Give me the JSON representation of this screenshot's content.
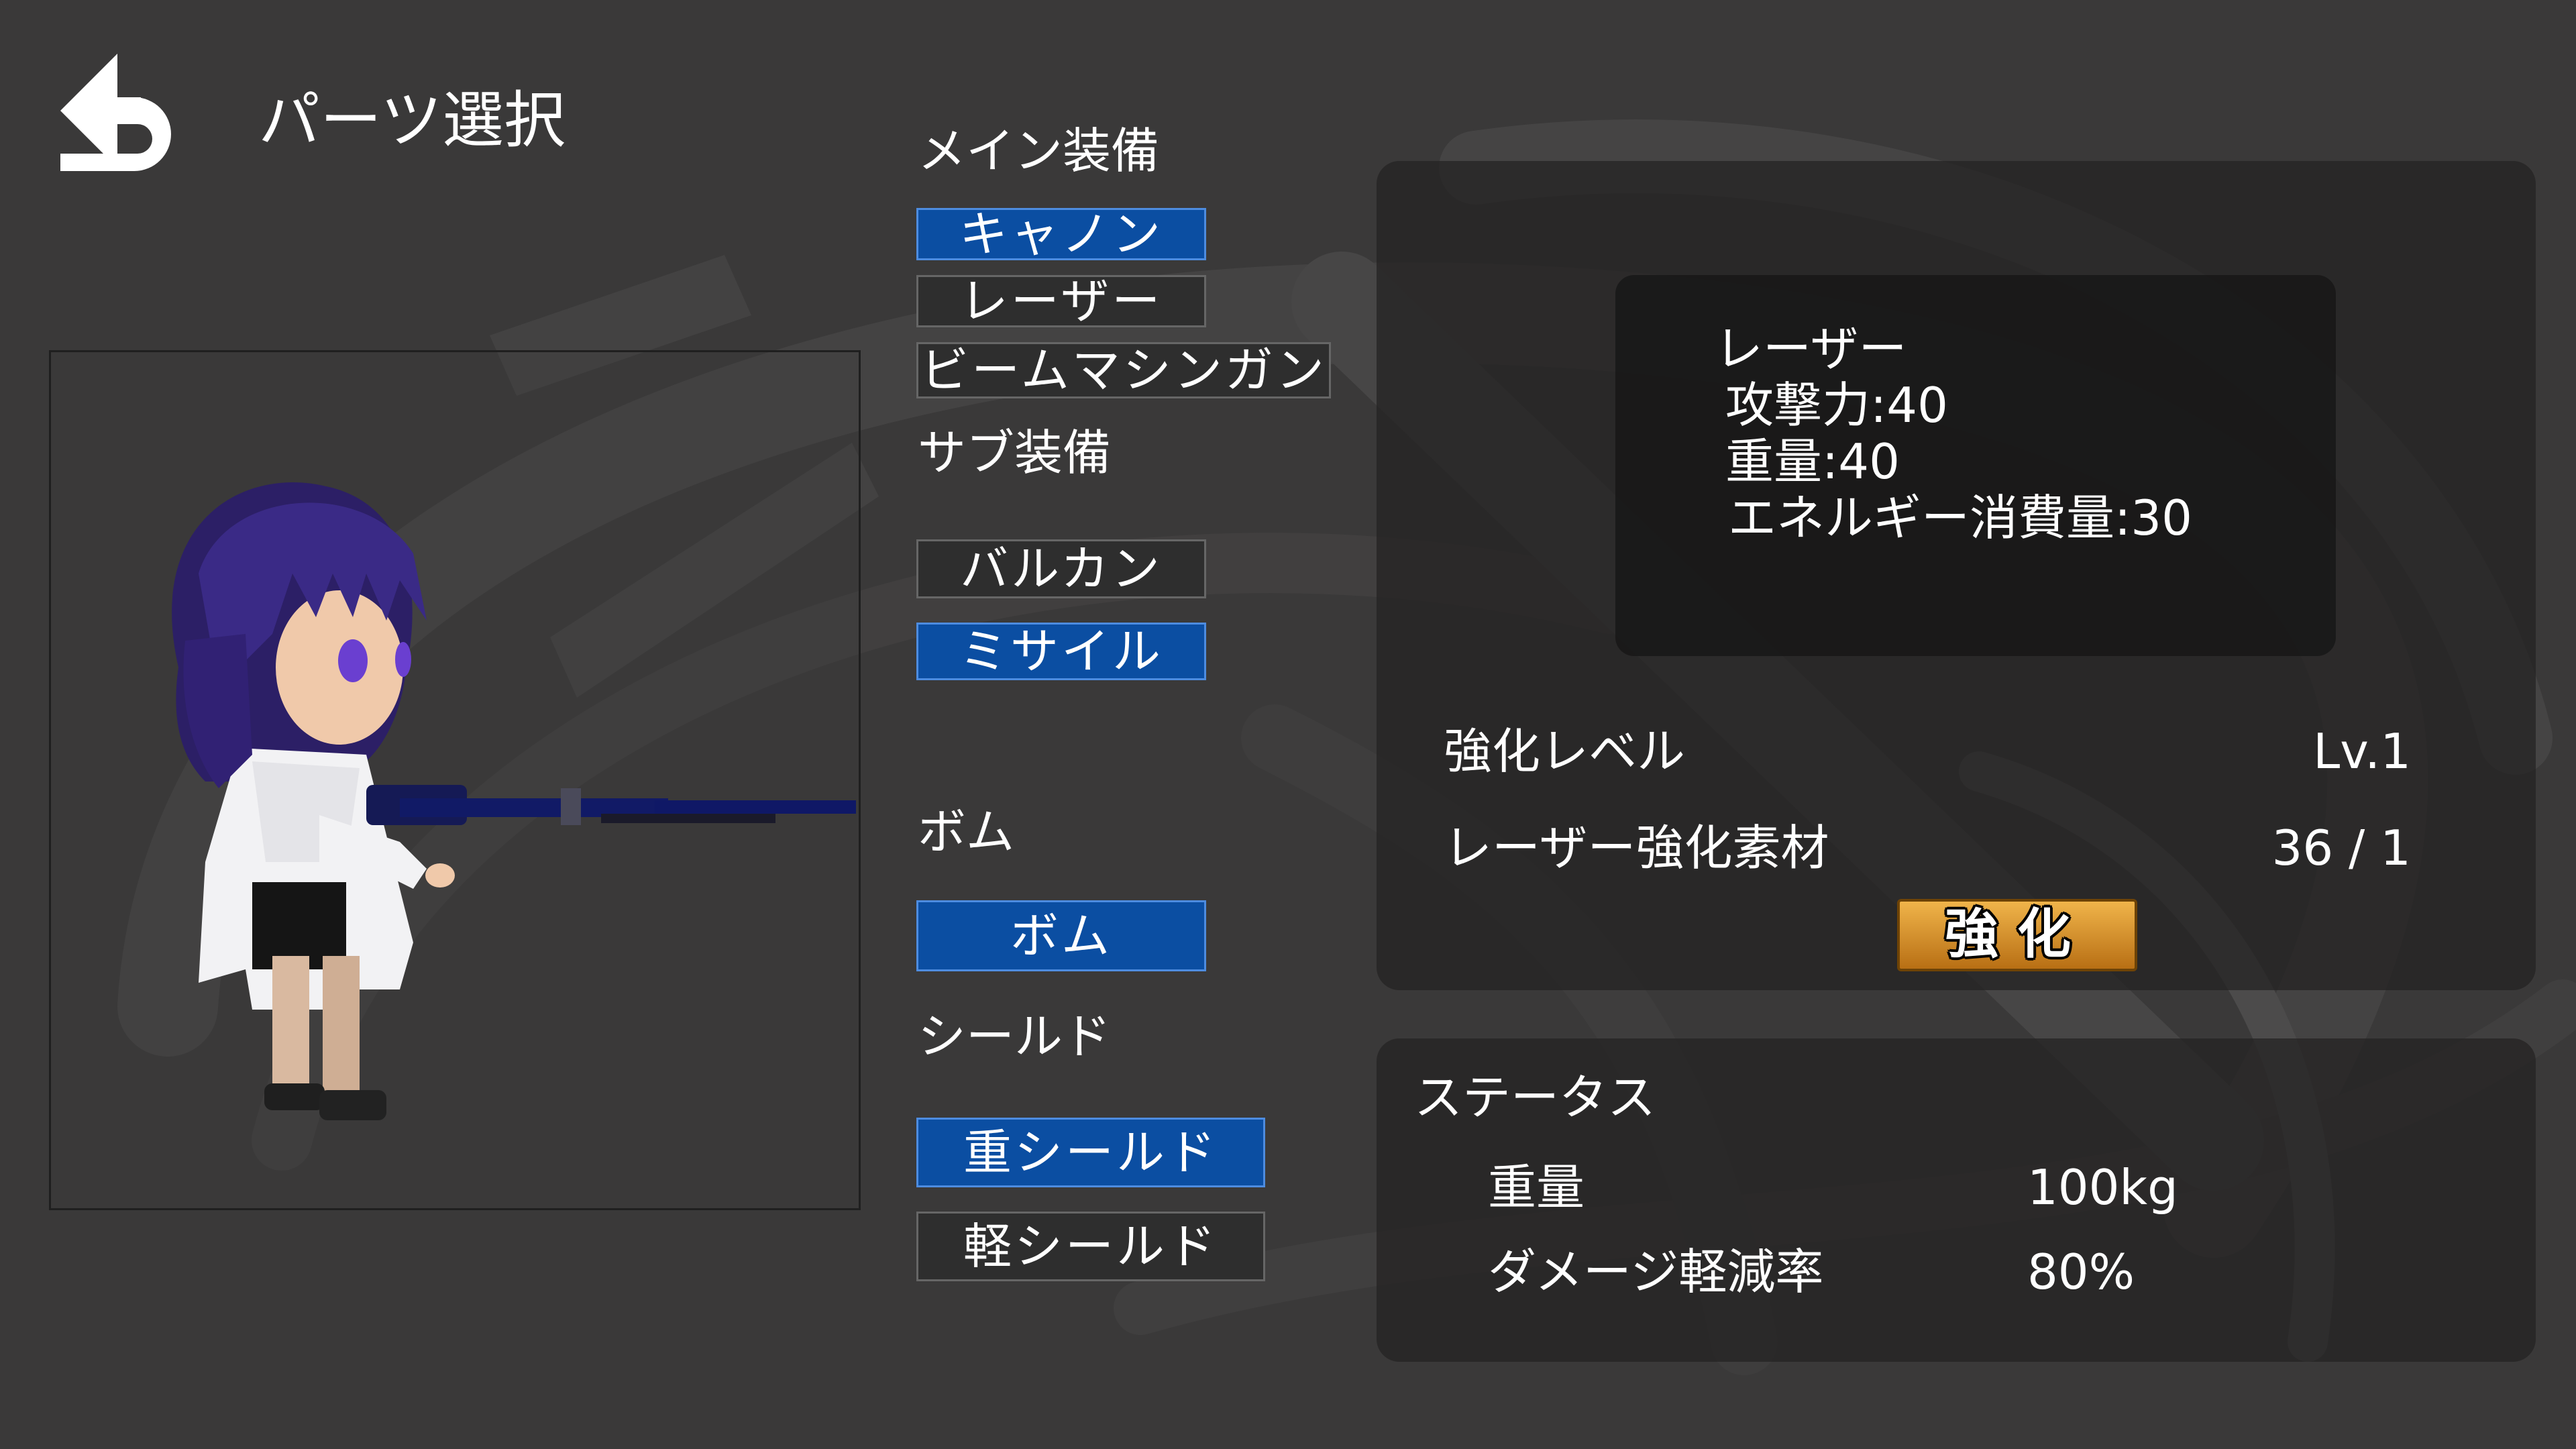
{
  "header": {
    "title": "パーツ選択"
  },
  "icons": {
    "back": "back-arrow-icon"
  },
  "main_weapon": {
    "label": "メイン装備",
    "options": [
      {
        "label": "キャノン",
        "selected": true
      },
      {
        "label": "レーザー",
        "selected": false
      },
      {
        "label": "ビームマシンガン",
        "selected": false
      }
    ]
  },
  "sub_weapon": {
    "label": "サブ装備",
    "options": [
      {
        "label": "バルカン",
        "selected": false
      },
      {
        "label": "ミサイル",
        "selected": true
      }
    ]
  },
  "bomb": {
    "label": "ボム",
    "options": [
      {
        "label": "ボム",
        "selected": true
      }
    ]
  },
  "shield": {
    "label": "シールド",
    "options": [
      {
        "label": "重シールド",
        "selected": true
      },
      {
        "label": "軽シールド",
        "selected": false
      }
    ]
  },
  "detail": {
    "name": "レーザー",
    "attack": "攻撃力:40",
    "weight": "重量:40",
    "energy": "エネルギー消費量:30",
    "upgrade_level_label": "強化レベル",
    "upgrade_level_value": "Lv.1",
    "material_label": "レーザー強化素材",
    "material_value": "36 / 1",
    "upgrade_button": "強化"
  },
  "status": {
    "title": "ステータス",
    "rows": [
      {
        "label": "重量",
        "value": "100kg"
      },
      {
        "label": "ダメージ軽減率",
        "value": "80%"
      }
    ]
  },
  "colors": {
    "background": "#3a3939",
    "selected_button": "#0b4ea2",
    "unselected_button": "#2e2e2e",
    "upgrade_button": "#d8921f"
  }
}
